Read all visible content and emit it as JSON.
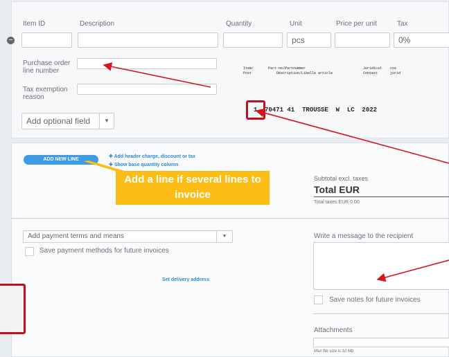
{
  "columns": [
    "Item ID",
    "Description",
    "Quantity",
    "Unit",
    "Price per unit",
    "Tax"
  ],
  "line": {
    "unit_value": "pcs",
    "tax_value": "0%"
  },
  "optional": {
    "po_label": "Purchase order line number",
    "tax_exempt_label": "Tax exemption reason",
    "add_field": "Add optional field"
  },
  "scan": {
    "h1": "Item/\nPost",
    "h2": "Part no/Partnummer\n    Description/Libelle article",
    "h3": "Juridical\nContext",
    "h4": "cos\njurid",
    "row_num": "1",
    "row_text": "70471 41  TROUSSE  W  LC  2022"
  },
  "actions": {
    "add_line": "ADD NEW LINE",
    "add_header": "Add header charge, discount or tax",
    "show_base": "Show base quantity column",
    "set_delivery": "Set delivery address"
  },
  "callout": "Add a line if several lines to invoice",
  "totals": {
    "subtotal_label": "Subtotal excl. taxes",
    "total_label": "Total EUR",
    "taxes_label": "Total taxes EUR 0.00"
  },
  "payment": {
    "select_label": "Add payment terms and means",
    "save_label": "Save payment methods for future invoices"
  },
  "message": {
    "label": "Write a message to the recipient",
    "save_notes": "Save notes for future invoices"
  },
  "attachments": {
    "label": "Attachments",
    "hint": "Max file size is 10 Mb"
  },
  "colors": {
    "arrow": "#d4141f",
    "callout": "#fbbd16",
    "button": "#3f9be3"
  }
}
